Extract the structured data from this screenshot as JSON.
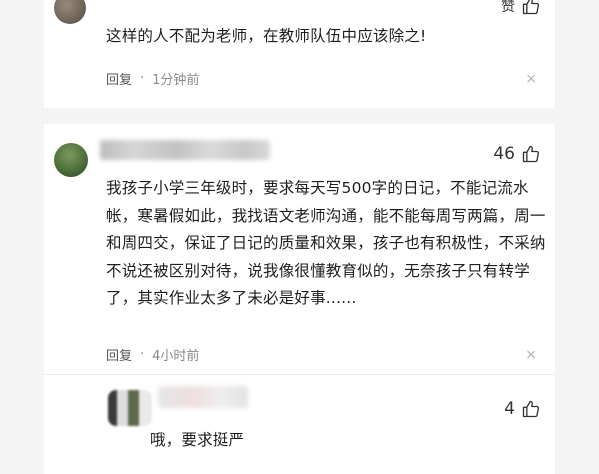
{
  "comments": [
    {
      "likes_label": "赞",
      "text": "这样的人不配为老师，在教师队伍中应该除之!",
      "reply_label": "回复",
      "separator": "·",
      "time": "1分钟前",
      "close_symbol": "×"
    },
    {
      "likes": "46",
      "text": "我孩子小学三年级时，要求每天写500字的日记，不能记流水帐，寒暑假如此，我找语文老师沟通，能不能每周写两篇，周一和周四交，保证了日记的质量和效果，孩子也有积极性，不采纳不说还被区别对待，说我像很懂教育似的，无奈孩子只有转学了，其实作业太多了未必是好事......",
      "reply_label": "回复",
      "separator": "·",
      "time": "4小时前",
      "close_symbol": "×"
    },
    {
      "likes": "4",
      "text": "哦，要求挺严"
    }
  ]
}
